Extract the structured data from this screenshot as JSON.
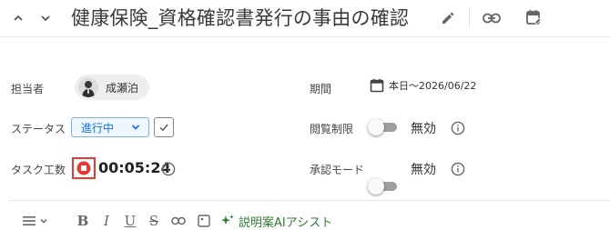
{
  "header": {
    "title": "健康保険_資格確認書発行の事由の確認"
  },
  "fields": {
    "assignee": {
      "label": "担当者",
      "name": "成瀬泊"
    },
    "period": {
      "label": "期間",
      "value": "本日～2026/06/22"
    },
    "status": {
      "label": "ステータス",
      "selected": "進行中"
    },
    "view_restriction": {
      "label": "閲覧制限",
      "state": "無効"
    },
    "task_hours": {
      "label": "タスク工数",
      "time": "00:05:24"
    },
    "approval_mode": {
      "label": "承認モード",
      "state": "無効"
    }
  },
  "editor_toolbar": {
    "ai_assist_label": "説明案AIアシスト"
  },
  "colors": {
    "accent_blue": "#1a73e8",
    "timer_red": "#e53935",
    "ai_green": "#2e7d32"
  },
  "icons": {
    "header": [
      "chevron-up-icon",
      "chevron-down-icon",
      "edit-pencil-icon",
      "link-icon",
      "calendar-edit-icon"
    ],
    "fields": [
      "calendar-icon",
      "check-icon",
      "stop-record-icon",
      "info-icon"
    ],
    "toolbar": [
      "list-icon",
      "bold-icon",
      "italic-icon",
      "underline-icon",
      "strikethrough-icon",
      "link-icon",
      "image-icon",
      "sparkle-icon"
    ]
  }
}
